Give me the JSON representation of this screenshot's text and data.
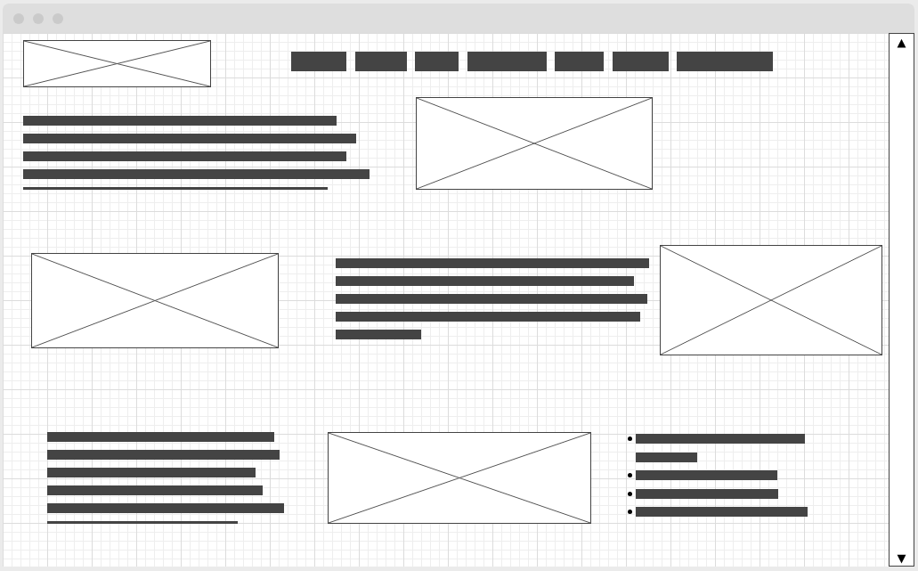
{
  "scrollbar": {
    "up_arrow": "▲",
    "down_arrow": "▼"
  }
}
